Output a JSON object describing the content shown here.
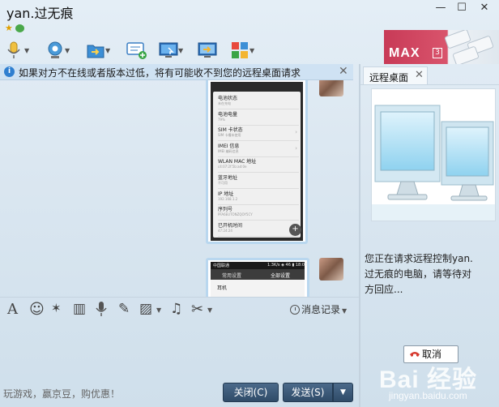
{
  "window": {
    "title": "yan.过无痕",
    "min_glyph": "—",
    "max_glyph": "☐",
    "close_glyph": "✕"
  },
  "title_icons": [
    "star-icon",
    "chat-status-icon"
  ],
  "toolbar": {
    "items": [
      {
        "name": "voice-call-button",
        "icon": "microphone-icon",
        "has_menu": true
      },
      {
        "name": "video-call-button",
        "icon": "webcam-icon",
        "has_menu": true
      },
      {
        "name": "send-file-button",
        "icon": "folder-icon",
        "has_menu": true
      },
      {
        "name": "create-discussion-button",
        "icon": "discussion-add-icon",
        "has_menu": false
      },
      {
        "name": "remote-desktop-button",
        "icon": "remote-desktop-icon",
        "has_menu": true
      },
      {
        "name": "screen-share-button",
        "icon": "screen-share-icon",
        "has_menu": false
      },
      {
        "name": "app-center-button",
        "icon": "app-grid-icon",
        "has_menu": true
      }
    ]
  },
  "banner": {
    "text": "MAX",
    "number": "3"
  },
  "notice": {
    "text": "如果对方不在线或者版本过低，将有可能收不到您的远程桌面请求",
    "close": "✕"
  },
  "chat": {
    "image1": {
      "rows": [
        {
          "title": "电池状态",
          "sub": "未在充电",
          "arrow": ""
        },
        {
          "title": "电池电量",
          "sub": "79%",
          "arrow": ""
        },
        {
          "title": "SIM 卡状态",
          "sub": "SIM 卡槽未使用",
          "arrow": "›"
        },
        {
          "title": "IMEI 信息",
          "sub": "IMEI 编码信息",
          "arrow": "›"
        },
        {
          "title": "WLAN MAC 地址",
          "sub": "c4:07:2f:5b:ad:0e",
          "arrow": ""
        },
        {
          "title": "蓝牙地址",
          "sub": "不可用",
          "arrow": ""
        },
        {
          "title": "IP 地址",
          "sub": "192.168.1.2",
          "arrow": ""
        },
        {
          "title": "序列号",
          "sub": "PFA6EUTONZQOY5CY",
          "arrow": ""
        },
        {
          "title": "已开机时间",
          "sub": "47:24:24",
          "arrow": ""
        }
      ],
      "zoom": "+"
    },
    "image2": {
      "carrier": "中国联通",
      "status": "1.3K/s ◈ 46 ▮ 18:08",
      "tabs": [
        "常用设置",
        "全部设置"
      ],
      "item": "耳机"
    },
    "scroll_down": "﹀"
  },
  "format_bar": {
    "tools": [
      {
        "name": "font-button",
        "icon": "font-icon",
        "glyph": "A"
      },
      {
        "name": "emoji-button",
        "icon": "smiley-icon",
        "glyph": "☺"
      },
      {
        "name": "magic-button",
        "icon": "magic-wand-icon",
        "glyph": "✶"
      },
      {
        "name": "cartoon-button",
        "icon": "film-icon",
        "glyph": "▥"
      },
      {
        "name": "voice-message-button",
        "icon": "mic-icon",
        "glyph": "🎙"
      },
      {
        "name": "doodle-button",
        "icon": "pen-icon",
        "glyph": "✎"
      },
      {
        "name": "image-button",
        "icon": "image-icon",
        "glyph": "▨"
      },
      {
        "name": "music-button",
        "icon": "music-icon",
        "glyph": "♫"
      },
      {
        "name": "screenshot-button",
        "icon": "scissors-icon",
        "glyph": "✂"
      }
    ],
    "history": "消息记录"
  },
  "bottom": {
    "promo": "玩游戏，赢京豆，购优惠！",
    "close_label": "关闭(C)",
    "send_label": "发送(S)",
    "send_menu": "▼"
  },
  "right_panel": {
    "tab_label": "远程桌面",
    "tab_close": "✕",
    "message_lines": [
      "您正在请求远程控制yan.",
      "过无痕的电脑，请等待对",
      "方回应..."
    ],
    "cancel_label": "取消",
    "watermark": {
      "logo": "Bai 经验",
      "url": "jingyan.baidu.com"
    }
  }
}
